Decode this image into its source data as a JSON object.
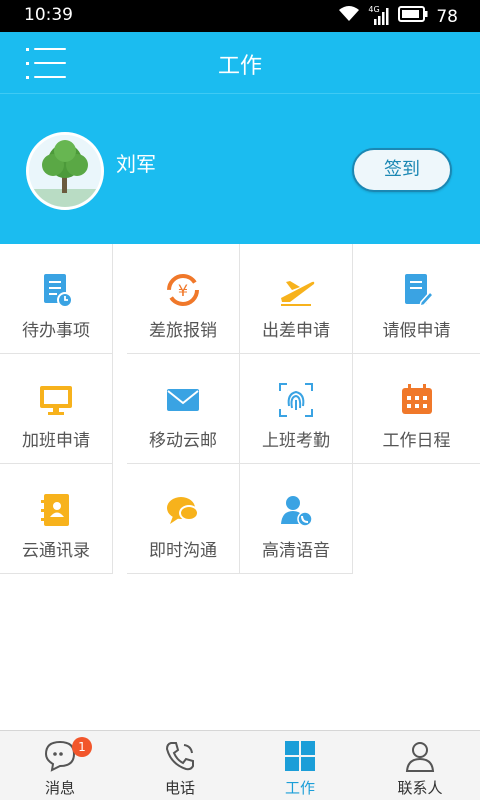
{
  "status_bar": {
    "time": "10:39",
    "network": "4G",
    "battery": "78",
    "icons": [
      "wifi-icon",
      "signal-icon",
      "battery-icon"
    ]
  },
  "header": {
    "title": "工作",
    "icons": [
      "menu-icon"
    ]
  },
  "profile": {
    "name": "刘军",
    "sign_in_label": "签到",
    "avatar_icon": "tree-avatar"
  },
  "apps": [
    {
      "label": "待办事项",
      "icon": "todo-icon",
      "color": "#3aa3e3"
    },
    {
      "label": "差旅报销",
      "icon": "expense-icon",
      "color": "#f0782a"
    },
    {
      "label": "出差申请",
      "icon": "plane-icon",
      "color": "#f7b21c"
    },
    {
      "label": "请假申请",
      "icon": "leave-icon",
      "color": "#3aa3e3"
    },
    {
      "label": "加班申请",
      "icon": "overtime-icon",
      "color": "#f7b21c"
    },
    {
      "label": "移动云邮",
      "icon": "mail-icon",
      "color": "#3aa3e3"
    },
    {
      "label": "上班考勤",
      "icon": "fingerprint-icon",
      "color": "#3aa3e3"
    },
    {
      "label": "工作日程",
      "icon": "calendar-icon",
      "color": "#f0782a"
    },
    {
      "label": "云通讯录",
      "icon": "contacts-book-icon",
      "color": "#f7b21c"
    },
    {
      "label": "即时沟通",
      "icon": "chat-icon",
      "color": "#f7b21c"
    },
    {
      "label": "高清语音",
      "icon": "voice-call-icon",
      "color": "#3aa3e3"
    }
  ],
  "tabbar": {
    "tabs": [
      {
        "label": "消息",
        "icon": "message-icon",
        "badge": "1"
      },
      {
        "label": "电话",
        "icon": "phone-icon"
      },
      {
        "label": "工作",
        "icon": "work-grid-icon",
        "active": true
      },
      {
        "label": "联系人",
        "icon": "contacts-icon"
      }
    ]
  },
  "colors": {
    "primary": "#1bbcf0",
    "active_tab": "#1b9ed8",
    "badge": "#f2562b"
  }
}
